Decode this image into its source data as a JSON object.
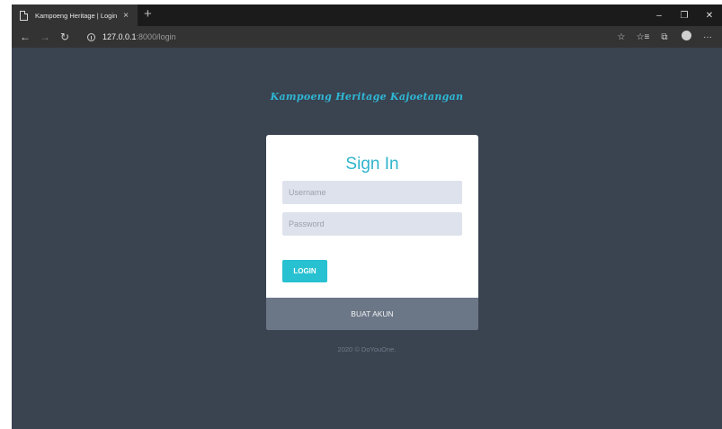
{
  "browser": {
    "tab_title": "Kampoeng Heritage | Login",
    "tab_close": "×",
    "new_tab": "+",
    "url_host": "127.0.0.1",
    "url_rest": ":8000/login",
    "window_controls": {
      "minimize": "–",
      "restore": "❐",
      "close": "✕"
    },
    "nav": {
      "back": "←",
      "forward": "→",
      "reload": "↻"
    },
    "toolbar": {
      "favorite": "☆",
      "favorites_bar": "☆≡",
      "collections": "⧉",
      "more": "···"
    }
  },
  "page": {
    "brand": "Kampoeng Heritage Kajoetangan",
    "card": {
      "title": "Sign In",
      "username_placeholder": "Username",
      "password_placeholder": "Password",
      "login_label": "LOGIN",
      "create_account_label": "BUAT AKUN"
    },
    "copyright": "2020 © DoYouOne."
  },
  "colors": {
    "page_bg": "#3a4350",
    "accent": "#2fb5cc",
    "button": "#27c1d1",
    "card_footer": "#6b7686",
    "input_bg": "#dee2ec"
  }
}
